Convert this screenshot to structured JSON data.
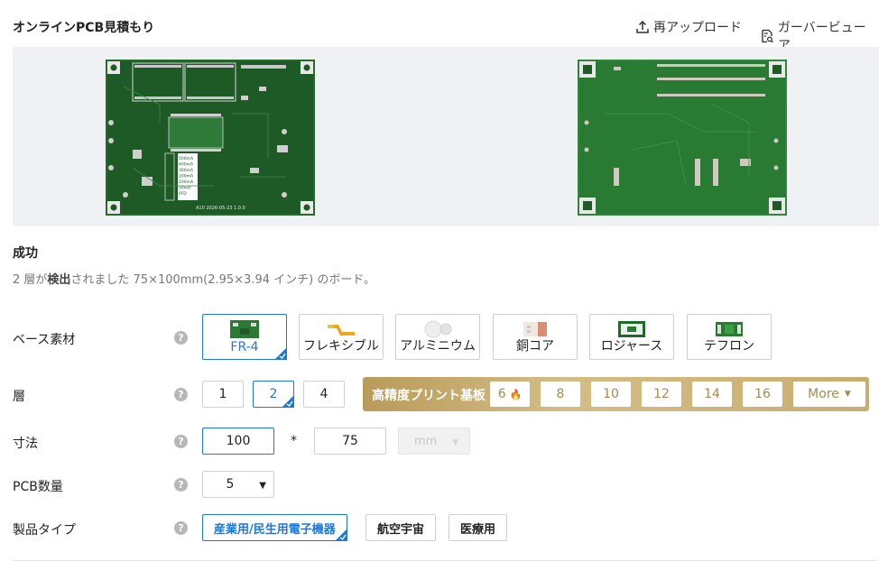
{
  "header": {
    "title": "オンラインPCB見積もり",
    "reupload_label": "再アップロード",
    "gerber_viewer_label": "ガーバービューア"
  },
  "preview": {
    "top_silkscreen_text": "A10 2026-05-23 1.0.0",
    "current_list": [
      "500mA",
      "400mA",
      "300mA",
      "200mA",
      "100mA",
      "50mA",
      "PFD"
    ]
  },
  "status": {
    "title": "成功",
    "desc_prefix": "2 層が",
    "desc_bold": "検出",
    "desc_suffix": "されました 75×100mm(2.95×3.94 インチ) のボード。"
  },
  "rows": {
    "base_material": {
      "label": "ベース素材",
      "options": [
        "FR-4",
        "フレキシブル",
        "アルミニウム",
        "銅コア",
        "ロジャース",
        "テフロン"
      ],
      "selected": "FR-4"
    },
    "layers": {
      "label": "層",
      "options": [
        "1",
        "2",
        "4"
      ],
      "selected": "2",
      "high_precision_label": "高精度プリント基板",
      "high_precision_options": [
        "6",
        "8",
        "10",
        "12",
        "14",
        "16"
      ],
      "more_label": "More"
    },
    "dimensions": {
      "label": "寸法",
      "width": "100",
      "separator": "*",
      "height": "75",
      "unit": "mm"
    },
    "quantity": {
      "label": "PCB数量",
      "value": "5"
    },
    "product_type": {
      "label": "製品タイプ",
      "options": [
        "産業用/民生用電子機器",
        "航空宇宙",
        "医療用"
      ],
      "selected": "産業用/民生用電子機器"
    }
  },
  "colors": {
    "accent": "#1e78d8",
    "pcb_green": "#1d5a25",
    "gold": "#c9ad70"
  }
}
